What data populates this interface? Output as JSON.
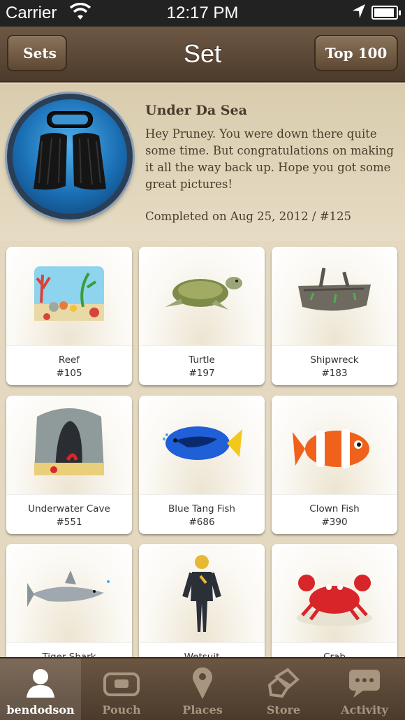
{
  "status_bar": {
    "carrier": "Carrier",
    "time": "12:17 PM"
  },
  "nav": {
    "back_label": "Sets",
    "title": "Set",
    "top_label": "Top 100"
  },
  "set": {
    "title": "Under Da Sea",
    "description": "Hey Pruney. You were down there quite some time. But congratulations on making it all the way back up. Hope you got some great pictures!",
    "completed": "Completed on Aug 25, 2012  /  #125",
    "badge_icon": "flippers-mask-icon"
  },
  "items": [
    {
      "name": "Reef",
      "number": "#105",
      "icon": "reef-icon"
    },
    {
      "name": "Turtle",
      "number": "#197",
      "icon": "turtle-icon"
    },
    {
      "name": "Shipwreck",
      "number": "#183",
      "icon": "shipwreck-icon"
    },
    {
      "name": "Underwater Cave",
      "number": "#551",
      "icon": "cave-icon"
    },
    {
      "name": "Blue Tang Fish",
      "number": "#686",
      "icon": "blue-tang-icon"
    },
    {
      "name": "Clown Fish",
      "number": "#390",
      "icon": "clownfish-icon"
    },
    {
      "name": "Tiger Shark",
      "number": "",
      "icon": "shark-icon"
    },
    {
      "name": "Wetsuit",
      "number": "",
      "icon": "wetsuit-icon"
    },
    {
      "name": "Crab",
      "number": "",
      "icon": "crab-icon"
    }
  ],
  "tabs": [
    {
      "label": "bendodson",
      "icon": "user-icon",
      "active": true
    },
    {
      "label": "Pouch",
      "icon": "pouch-icon"
    },
    {
      "label": "Places",
      "icon": "pin-icon"
    },
    {
      "label": "Store",
      "icon": "store-icon"
    },
    {
      "label": "Activity",
      "icon": "chat-icon"
    }
  ],
  "colors": {
    "background": "#e4d9c0",
    "nav": "#5d4834",
    "text": "#4a3b2c"
  }
}
